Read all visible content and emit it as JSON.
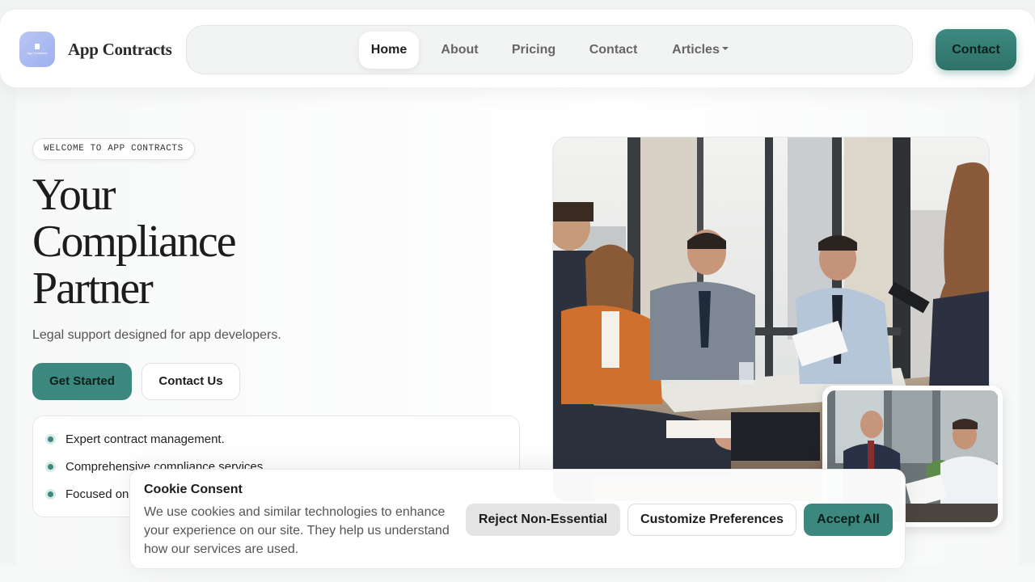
{
  "header": {
    "brand": "App Contracts",
    "logo_text": "App Contracts",
    "nav": [
      {
        "label": "Home",
        "active": true
      },
      {
        "label": "About",
        "active": false
      },
      {
        "label": "Pricing",
        "active": false
      },
      {
        "label": "Contact",
        "active": false
      },
      {
        "label": "Articles",
        "active": false,
        "dropdown": true
      }
    ],
    "cta_label": "Contact"
  },
  "hero": {
    "badge": "WELCOME TO APP CONTRACTS",
    "title_line1": "Your",
    "title_line2": "Compliance",
    "title_line3": "Partner",
    "subtitle": "Legal support designed for app developers.",
    "primary_button": "Get Started",
    "secondary_button": "Contact Us",
    "features": [
      "Expert contract management.",
      "Comprehensive compliance services.",
      "Focused on"
    ]
  },
  "cookie": {
    "title": "Cookie Consent",
    "text": "We use cookies and similar technologies to enhance your experience on our site. They help us understand how our services are used.",
    "reject_label": "Reject Non-Essential",
    "customize_label": "Customize Preferences",
    "accept_label": "Accept All"
  },
  "colors": {
    "accent": "#3c887e",
    "logo": "#a8b8f1"
  }
}
